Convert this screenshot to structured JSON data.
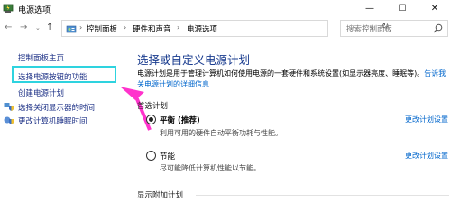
{
  "window": {
    "title": "电源选项",
    "minimize_glyph": "—",
    "maximize_glyph": "☐",
    "close_glyph": "✕"
  },
  "nav": {
    "back_glyph": "←",
    "forward_glyph": "→",
    "recent_glyph": "⌄",
    "up_glyph": "↑",
    "breadcrumb": [
      {
        "label": "控制面板"
      },
      {
        "label": "硬件和声音"
      },
      {
        "label": "电源选项"
      }
    ],
    "separator": "›",
    "dropdown_glyph": "⌄",
    "refresh_glyph": "↻",
    "search_placeholder": "搜索控制面板"
  },
  "sidebar": {
    "items": [
      {
        "label": "控制面板主页"
      },
      {
        "label": "选择电源按钮的功能"
      },
      {
        "label": "创建电源计划"
      },
      {
        "label": "选择关闭显示器的时间"
      },
      {
        "label": "更改计算机睡眠时间"
      }
    ]
  },
  "main": {
    "title": "选择或自定义电源计划",
    "description_line1": "电源计划是用于管理计算机如何使用电源的一套硬件和系统设置(如显示器亮度、睡眠等)。",
    "description_link1": "告诉我",
    "description_line2": "关电源计划的详细信息",
    "preferred_label": "首选计划",
    "plans": [
      {
        "name": "平衡 (推荐)",
        "desc": "利用可用的硬件自动平衡功耗与性能。",
        "change": "更改计划设置",
        "selected": true
      },
      {
        "name": "节能",
        "desc": "尽可能降低计算机性能以节能。",
        "change": "更改计划设置",
        "selected": false
      }
    ],
    "extra_label": "显示附加计划"
  },
  "colors": {
    "accent_link": "#0066cc",
    "sidebar_link": "#1e3287",
    "title_blue": "#1a3c8f",
    "highlight": "#2ed3df",
    "arrow": "#ff33cc"
  }
}
